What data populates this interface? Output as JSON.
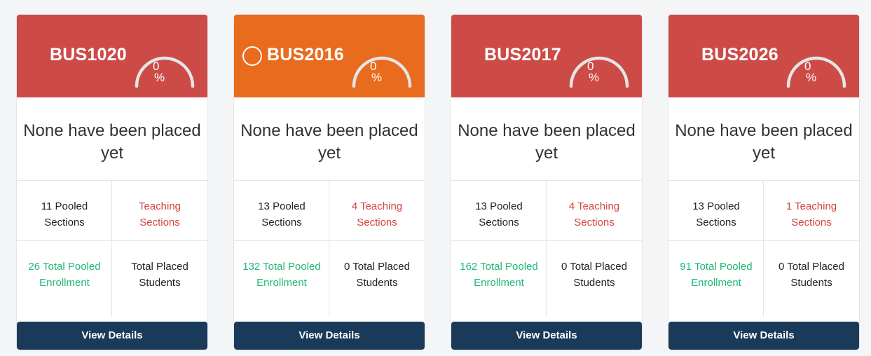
{
  "colors": {
    "failed_header": "#cd4b47",
    "pending_header": "#e86b1e",
    "button": "#1a3a5a",
    "red_text": "#d0443f",
    "green_text": "#1fb775"
  },
  "courses": [
    {
      "code": "BUS1020",
      "status": "failed",
      "status_icon": "x-circle-icon",
      "status_glyph": "✕",
      "progress_value": "0",
      "progress_unit": "%",
      "progress_fraction": 0,
      "message": "None have been placed yet",
      "pooled_sections": "11 Pooled Sections",
      "teaching_sections": "Teaching Sections",
      "pooled_enrollment": "26 Total Pooled Enrollment",
      "placed_students": "Total Placed Students",
      "button_label": "View Details"
    },
    {
      "code": "BUS2016",
      "status": "pending",
      "status_icon": "empty-circle-icon",
      "status_glyph": "",
      "progress_value": "0",
      "progress_unit": "%",
      "progress_fraction": 0,
      "message": "None have been placed yet",
      "pooled_sections": "13 Pooled Sections",
      "teaching_sections": "4 Teaching Sections",
      "pooled_enrollment": "132 Total Pooled Enrollment",
      "placed_students": "0 Total Placed Students",
      "button_label": "View Details"
    },
    {
      "code": "BUS2017",
      "status": "failed",
      "status_icon": "x-circle-icon",
      "status_glyph": "✕",
      "progress_value": "0",
      "progress_unit": "%",
      "progress_fraction": 0,
      "message": "None have been placed yet",
      "pooled_sections": "13 Pooled Sections",
      "teaching_sections": "4 Teaching Sections",
      "pooled_enrollment": "162 Total Pooled Enrollment",
      "placed_students": "0 Total Placed Students",
      "button_label": "View Details"
    },
    {
      "code": "BUS2026",
      "status": "failed",
      "status_icon": "x-circle-icon",
      "status_glyph": "✕",
      "progress_value": "0",
      "progress_unit": "%",
      "progress_fraction": 0,
      "message": "None have been placed yet",
      "pooled_sections": "13 Pooled Sections",
      "teaching_sections": "1 Teaching Sections",
      "pooled_enrollment": "91 Total Pooled Enrollment",
      "placed_students": "0 Total Placed Students",
      "button_label": "View Details"
    }
  ]
}
